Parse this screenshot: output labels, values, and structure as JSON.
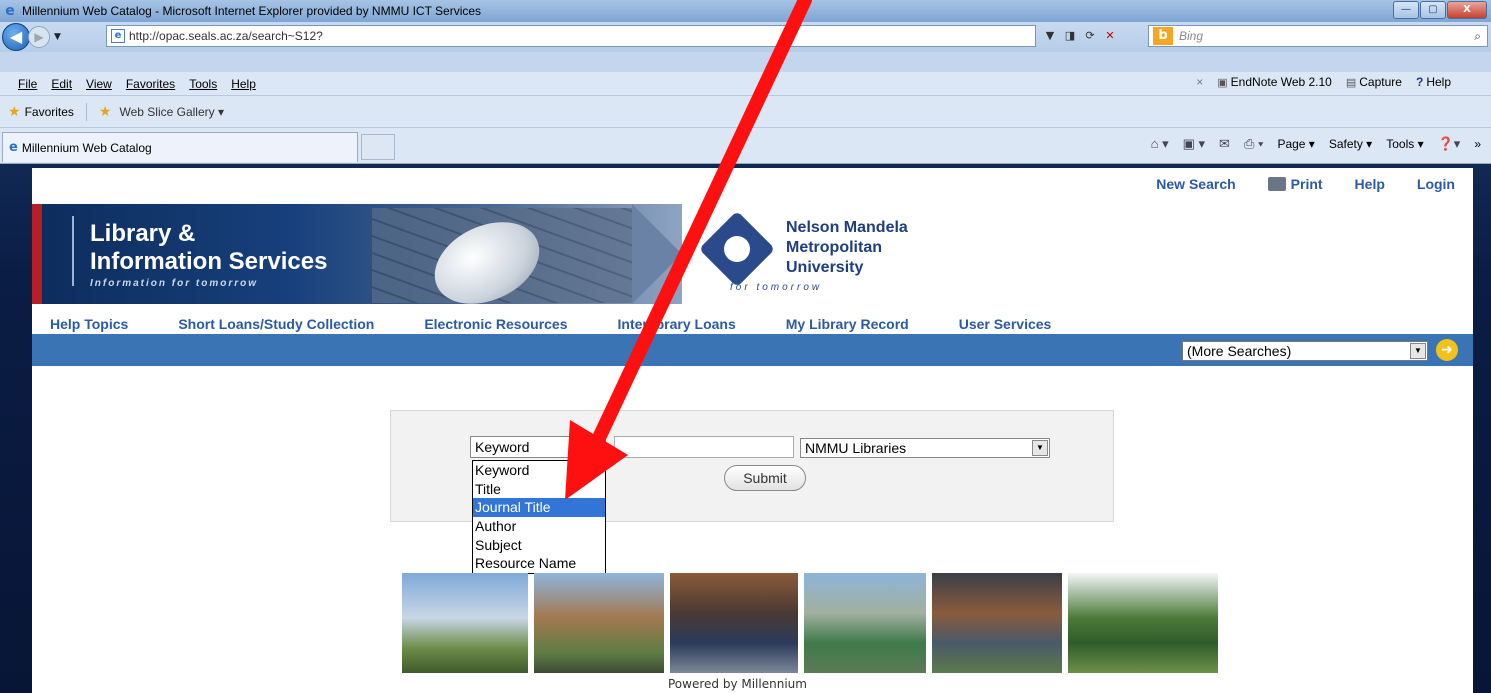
{
  "window": {
    "title": "Millennium Web Catalog - Microsoft Internet Explorer provided by NMMU ICT Services",
    "minimize_glyph": "—",
    "maximize_glyph": "▢",
    "close_glyph": "X"
  },
  "address_bar": {
    "url": "http://opac.seals.ac.za/search~S12?",
    "search_placeholder": "Bing"
  },
  "menu": {
    "items": [
      "File",
      "Edit",
      "View",
      "Favorites",
      "Tools",
      "Help"
    ],
    "close_glyph": "×",
    "endnote": "EndNote Web 2.10",
    "capture": "Capture",
    "help": "Help"
  },
  "favorites_bar": {
    "favorites_label": "Favorites",
    "web_slice_label": "Web Slice Gallery ▾"
  },
  "tabs": {
    "active_tab": "Millennium Web Catalog"
  },
  "command_bar": {
    "page": "Page ▾",
    "safety": "Safety ▾",
    "tools": "Tools ▾",
    "overflow": "»"
  },
  "page": {
    "top_links": {
      "new_search": "New Search",
      "print": "Print",
      "help": "Help",
      "login": "Login"
    },
    "banner": {
      "title_line1": "Library &",
      "title_line2": "Information Services",
      "tagline": "Information for tomorrow"
    },
    "university": {
      "name_line1": "Nelson Mandela",
      "name_line2": "Metropolitan",
      "name_line3": "University",
      "tagline": "for tomorrow"
    },
    "nav": [
      "Help Topics",
      "Short Loans/Study Collection",
      "Electronic Resources",
      "Interlibrary Loans",
      "My Library Record",
      "User Services"
    ],
    "more_searches": "(More Searches)",
    "search": {
      "type_selected": "Keyword",
      "query_value": "",
      "library_selected": "NMMU Libraries",
      "submit_label": "Submit",
      "type_options": [
        "Keyword",
        "Title",
        "Journal Title",
        "Author",
        "Subject",
        "Resource Name"
      ],
      "highlighted_option": "Journal Title"
    },
    "footer": "Powered by Millennium"
  },
  "colors": {
    "link_blue": "#2a5aa6",
    "nav_bar": "#3b74b4",
    "highlight": "#3375d6",
    "arrow_red": "#ff1010"
  }
}
